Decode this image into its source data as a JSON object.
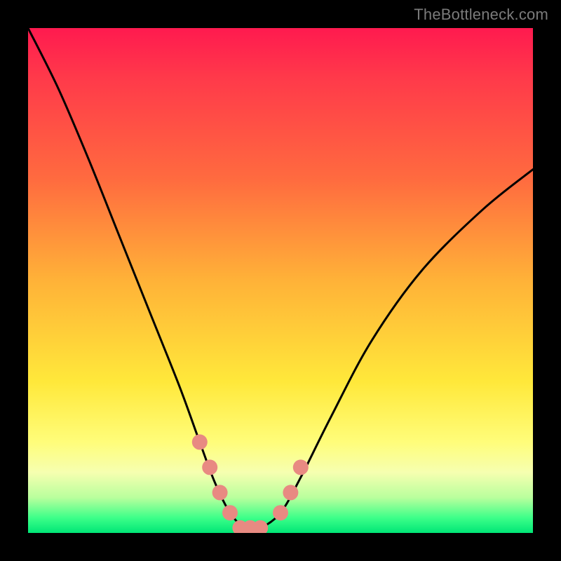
{
  "watermark": "TheBottleneck.com",
  "chart_data": {
    "type": "line",
    "title": "",
    "xlabel": "",
    "ylabel": "",
    "xlim": [
      0,
      100
    ],
    "ylim": [
      0,
      100
    ],
    "series": [
      {
        "name": "bottleneck-curve",
        "x": [
          0,
          6,
          12,
          18,
          24,
          30,
          34,
          37,
          40,
          43,
          46,
          50,
          54,
          60,
          68,
          78,
          90,
          100
        ],
        "values": [
          100,
          88,
          74,
          59,
          44,
          29,
          18,
          10,
          4,
          1,
          1,
          4,
          11,
          23,
          38,
          52,
          64,
          72
        ]
      }
    ],
    "markers": {
      "name": "highlight-points",
      "color": "#e88a82",
      "x": [
        34,
        36,
        38,
        40,
        42,
        44,
        46,
        50,
        52,
        54
      ],
      "values": [
        18,
        13,
        8,
        4,
        1,
        1,
        1,
        4,
        8,
        13
      ]
    },
    "background_gradient_stops": [
      {
        "pos": 0.0,
        "color": "#ff1a4f"
      },
      {
        "pos": 0.5,
        "color": "#ffb238"
      },
      {
        "pos": 0.82,
        "color": "#fffd7a"
      },
      {
        "pos": 1.0,
        "color": "#00e676"
      }
    ]
  }
}
